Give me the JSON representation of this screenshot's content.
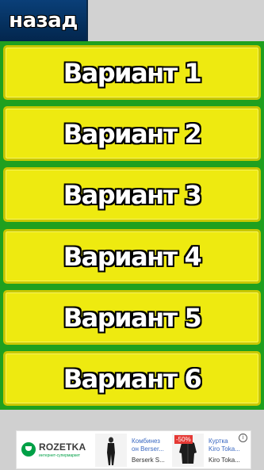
{
  "header": {
    "back_label": "назад"
  },
  "options": [
    {
      "label": "Вариант 1"
    },
    {
      "label": "Вариант 2"
    },
    {
      "label": "Вариант 3"
    },
    {
      "label": "Вариант 4"
    },
    {
      "label": "Вариант 5"
    },
    {
      "label": "Вариант 6"
    }
  ],
  "ad": {
    "brand": "ROZETKA",
    "tagline": "интернет-супермаркет",
    "cards": [
      {
        "title_1": "Комбинез",
        "title_2": "он Berser...",
        "subtitle": "Berserk S..."
      },
      {
        "badge": "-50%",
        "title_1": "Куртка",
        "title_2": "Kiro Toka...",
        "subtitle": "Kiro Toka..."
      }
    ],
    "info_icon": "i"
  },
  "colors": {
    "back_button": "#05305e",
    "option_fill": "#eeea10",
    "options_background": "#1fa01f",
    "page_background": "#d0d0d0"
  }
}
